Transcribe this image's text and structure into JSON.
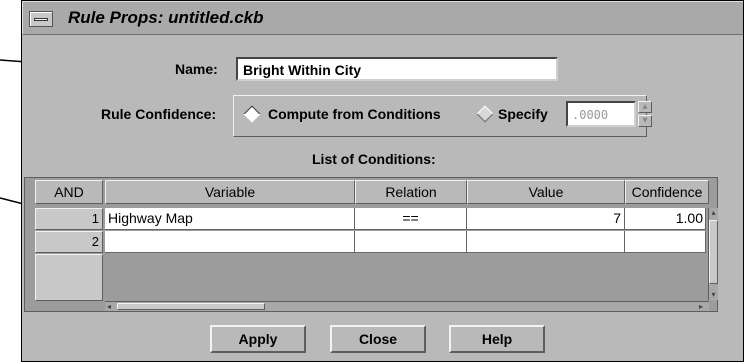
{
  "window": {
    "title": "Rule Props: untitled.ckb"
  },
  "form": {
    "name_label": "Name:",
    "name_value": "Bright Within City",
    "confidence_label": "Rule Confidence:",
    "option_compute": "Compute from Conditions",
    "option_specify": "Specify",
    "specify_value": ".0000",
    "selected_option": "Compute from Conditions"
  },
  "conditions": {
    "title": "List of Conditions:",
    "columns": [
      "AND",
      "Variable",
      "Relation",
      "Value",
      "Confidence"
    ],
    "rows": [
      {
        "and": "1",
        "variable": "Highway Map",
        "relation": "==",
        "value": "7",
        "confidence": "1.00"
      },
      {
        "and": "2",
        "variable": "",
        "relation": "",
        "value": "",
        "confidence": ""
      }
    ]
  },
  "buttons": {
    "apply": "Apply",
    "close": "Close",
    "help": "Help"
  }
}
